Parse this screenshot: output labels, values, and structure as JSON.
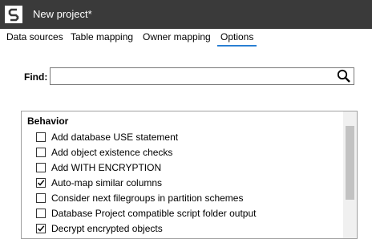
{
  "window": {
    "title": "New project*"
  },
  "tabs": [
    {
      "label": "Data sources",
      "active": false
    },
    {
      "label": "Table mapping",
      "active": false
    },
    {
      "label": "Owner mapping",
      "active": false
    },
    {
      "label": "Options",
      "active": true
    }
  ],
  "find": {
    "label": "Find:",
    "value": "",
    "placeholder": ""
  },
  "options": {
    "section_title": "Behavior",
    "items": [
      {
        "label": "Add database USE statement",
        "checked": false
      },
      {
        "label": "Add object existence checks",
        "checked": false
      },
      {
        "label": "Add WITH ENCRYPTION",
        "checked": false
      },
      {
        "label": "Auto-map similar columns",
        "checked": true
      },
      {
        "label": "Consider next filegroups in partition schemes",
        "checked": false
      },
      {
        "label": "Database Project compatible script folder output",
        "checked": false
      },
      {
        "label": "Decrypt encrypted objects",
        "checked": true
      }
    ]
  },
  "colors": {
    "titlebar": "#3a3a3a",
    "accent": "#2a7fd3"
  }
}
